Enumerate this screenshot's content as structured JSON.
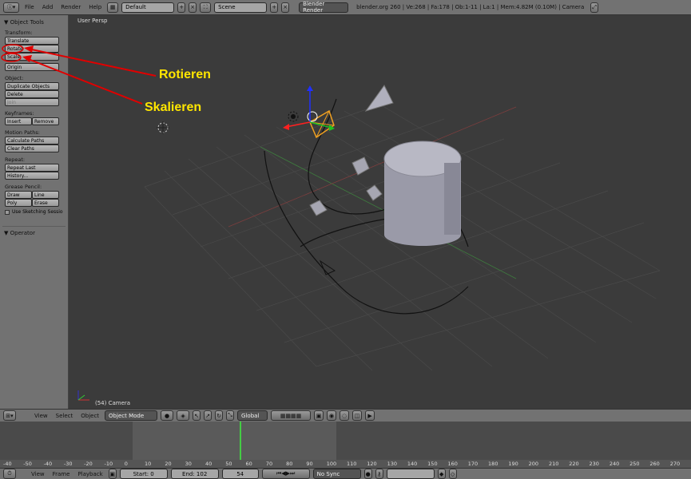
{
  "topbar": {
    "menus": [
      "File",
      "Add",
      "Render",
      "Help"
    ],
    "layout": "Default",
    "scene": "Scene",
    "engine": "Blender Render",
    "info": "blender.org 260 | Ve:268 | Fa:178 | Ob:1-11 | La:1 | Mem:4.82M (0.10M) | Camera"
  },
  "toolpanel": {
    "title": "Object Tools",
    "transform_label": "Transform:",
    "translate": "Translate",
    "rotate": "Rotate",
    "scale": "Scale",
    "origin": "Origin",
    "object_label": "Object:",
    "duplicate": "Duplicate Objects",
    "delete": "Delete",
    "join": "Join",
    "keyframes_label": "Keyframes:",
    "insert": "Insert",
    "remove": "Remove",
    "motion_label": "Motion Paths:",
    "calculate": "Calculate Paths",
    "clear": "Clear Paths",
    "repeat_label": "Repeat:",
    "repeat_last": "Repeat Last",
    "history": "History...",
    "grease_label": "Grease Pencil:",
    "draw": "Draw",
    "line": "Line",
    "poly": "Poly",
    "erase": "Erase",
    "sketch": "Use Sketching Sessio",
    "operator": "Operator"
  },
  "viewport": {
    "view_name": "User Persp",
    "object_label": "(54) Camera"
  },
  "annotations": {
    "rotate": "Rotieren",
    "scale": "Skalieren"
  },
  "view_header": {
    "menus": [
      "View",
      "Select",
      "Object"
    ],
    "mode": "Object Mode",
    "orientation": "Global"
  },
  "timeline": {
    "ticks": [
      "-40",
      "-50",
      "-40",
      "-30",
      "-20",
      "-10",
      "0",
      "10",
      "20",
      "30",
      "40",
      "50",
      "60",
      "70",
      "80",
      "90",
      "100",
      "110",
      "120",
      "130",
      "140",
      "150",
      "160",
      "170",
      "180",
      "190",
      "200",
      "210",
      "220",
      "230",
      "240",
      "250",
      "260",
      "270"
    ],
    "current_frame": 54,
    "start": 0,
    "end": 102
  },
  "footer": {
    "menus": [
      "View",
      "Frame",
      "Playback"
    ],
    "start": "Start: 0",
    "end": "End: 102",
    "frame": "54",
    "sync": "No Sync"
  },
  "colors": {
    "accent_red": "#e00000",
    "annotation_yellow": "#ffe600",
    "selected_orange": "#f0a020"
  }
}
